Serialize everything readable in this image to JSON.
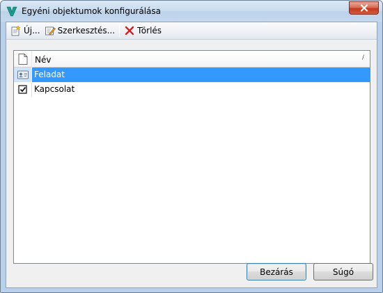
{
  "window": {
    "title": "Egyéni objektumok konfigurálása"
  },
  "toolbar": {
    "new_label": "Új...",
    "edit_label": "Szerkesztés...",
    "delete_label": "Törlés"
  },
  "list": {
    "column_name": "Név",
    "sort_indicator": "/",
    "rows": [
      {
        "label": "Feladat",
        "icon": "contact-card-icon",
        "selected": true
      },
      {
        "label": "Kapcsolat",
        "icon": "checkbox-icon",
        "selected": false
      }
    ]
  },
  "buttons": {
    "close_label": "Bezárás",
    "help_label": "Súgó"
  },
  "colors": {
    "selection": "#3399ff",
    "titlebar": "#c4d8ee",
    "close_button": "#c4391d"
  }
}
